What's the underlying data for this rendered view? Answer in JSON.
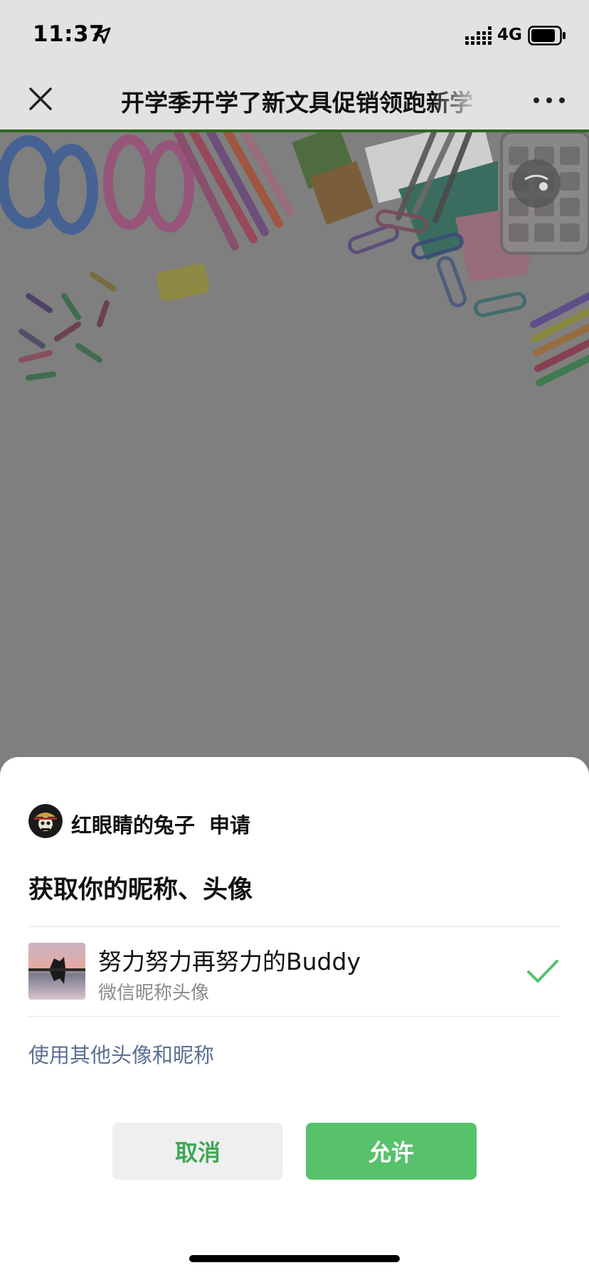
{
  "status_bar": {
    "time": "11:37",
    "network": "4G",
    "location_icon": "location-arrow-icon",
    "signal_icon": "signal-bars-icon",
    "battery_icon": "battery-icon"
  },
  "nav": {
    "title": "开学季开学了新文具促销领跑新学",
    "close_icon": "close-icon",
    "more_icon": "more-dots-icon"
  },
  "sheet": {
    "app_name": "红眼睛的兔子",
    "app_action": "申请",
    "request_title": "获取你的昵称、头像",
    "profile": {
      "name": "努力努力再努力的Buddy",
      "subtitle": "微信昵称头像",
      "selected": true
    },
    "other_profile_link": "使用其他头像和昵称",
    "cancel_label": "取消",
    "allow_label": "允许"
  },
  "colors": {
    "accent_green": "#57c26b",
    "cancel_text_green": "#3fa855",
    "link_blue": "#5d6f93",
    "overlay_gray": "#7f7f7f"
  }
}
